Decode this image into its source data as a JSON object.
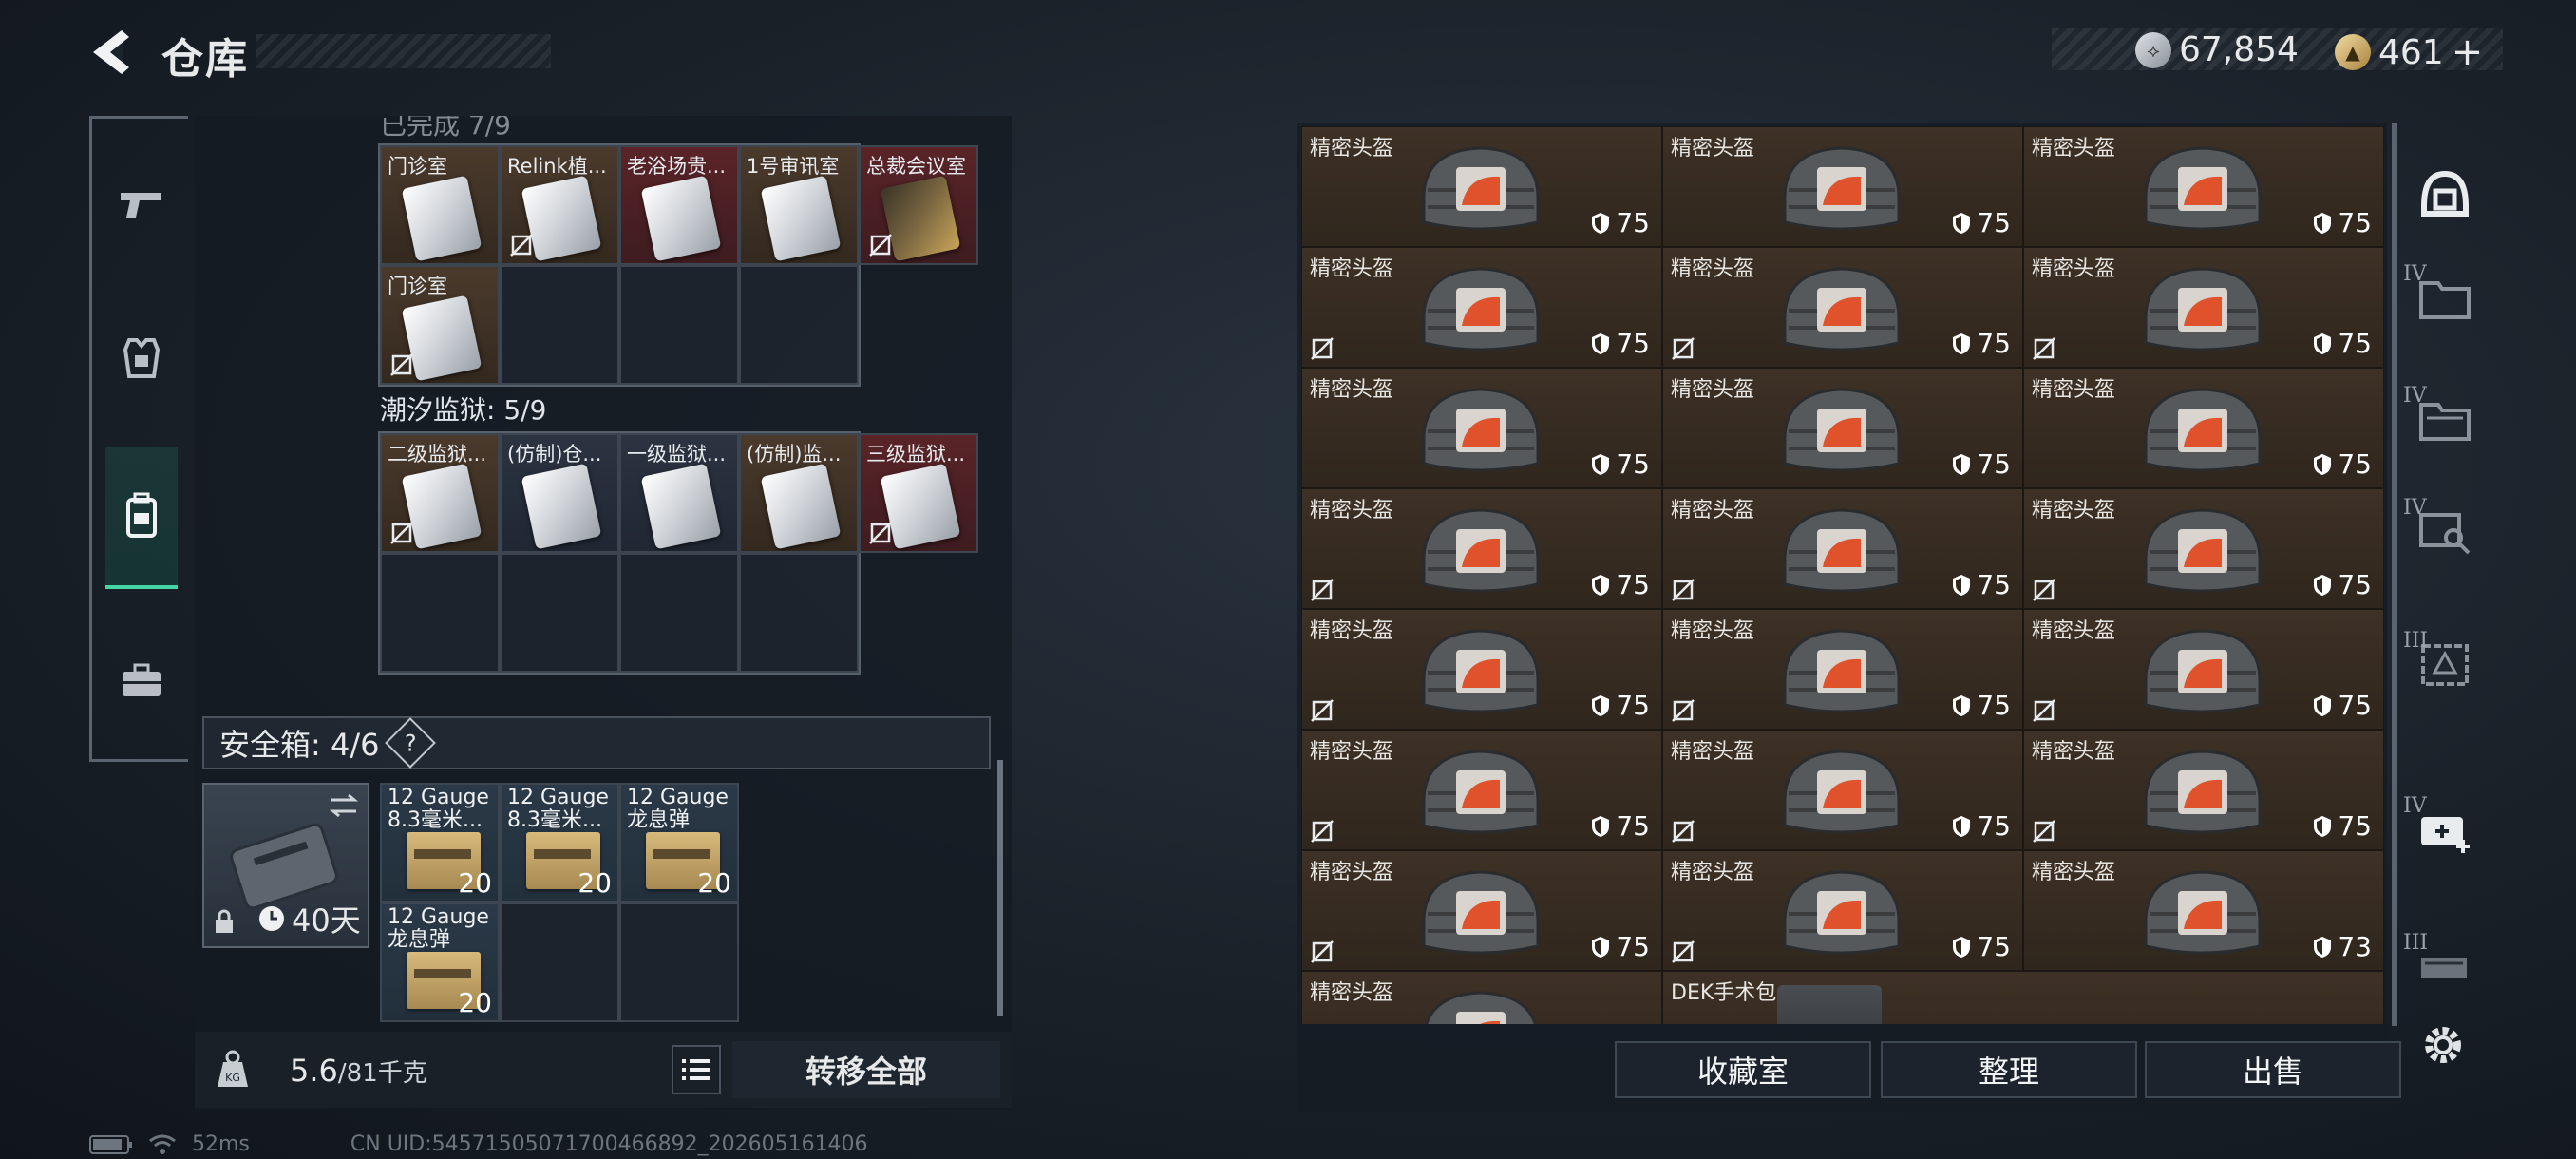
{
  "header": {
    "title": "仓库",
    "currency_silver": "67,854",
    "currency_gold": "461",
    "currency_add": "+"
  },
  "left_nav": [
    {
      "name": "weapons",
      "icon": "gun-icon"
    },
    {
      "name": "armor",
      "icon": "vest-icon"
    },
    {
      "name": "backpack",
      "icon": "backpack-icon"
    },
    {
      "name": "toolbox",
      "icon": "toolbox-icon"
    }
  ],
  "key_section_1": {
    "heading": "已完成 7/9",
    "cells": [
      {
        "label": "门诊室",
        "color": "tan",
        "no_trade": false,
        "gold": false
      },
      {
        "label": "Relink植...",
        "color": "tan",
        "no_trade": true,
        "gold": false
      },
      {
        "label": "老浴场贵...",
        "color": "red",
        "no_trade": false,
        "gold": false
      },
      {
        "label": "1号审讯室",
        "color": "tan",
        "no_trade": false,
        "gold": false
      },
      {
        "label": "总裁会议室",
        "color": "red",
        "no_trade": true,
        "gold": true
      },
      {
        "label": "门诊室",
        "color": "tan",
        "no_trade": true,
        "gold": false
      }
    ]
  },
  "key_section_2": {
    "heading": "潮汐监狱: 5/9",
    "cells": [
      {
        "label": "二级监狱...",
        "color": "tan",
        "no_trade": true
      },
      {
        "label": "(仿制)仓...",
        "color": "blue",
        "no_trade": false
      },
      {
        "label": "一级监狱...",
        "color": "blue",
        "no_trade": false
      },
      {
        "label": "(仿制)监...",
        "color": "tan",
        "no_trade": false
      },
      {
        "label": "三级监狱...",
        "color": "red",
        "no_trade": true
      }
    ]
  },
  "safe": {
    "heading": "安全箱: 4/6",
    "help": "?",
    "duration": "40天",
    "items": [
      {
        "line1": "12 Gauge",
        "line2": "8.3毫米...",
        "count": "20"
      },
      {
        "line1": "12 Gauge",
        "line2": "8.3毫米...",
        "count": "20"
      },
      {
        "line1": "12 Gauge",
        "line2": "龙息弹",
        "count": "20"
      },
      {
        "line1": "12 Gauge",
        "line2": "龙息弹",
        "count": "20"
      }
    ]
  },
  "weight": {
    "current": "5.6",
    "max": "/81千克",
    "transfer_all": "转移全部"
  },
  "helmets": {
    "label": "精密头盔",
    "rows": [
      [
        {
          "dur": "75",
          "nt": false
        },
        {
          "dur": "75",
          "nt": false
        },
        {
          "dur": "75",
          "nt": false
        }
      ],
      [
        {
          "dur": "75",
          "nt": true
        },
        {
          "dur": "75",
          "nt": true
        },
        {
          "dur": "75",
          "nt": true
        }
      ],
      [
        {
          "dur": "75",
          "nt": false
        },
        {
          "dur": "75",
          "nt": false
        },
        {
          "dur": "75",
          "nt": false
        }
      ],
      [
        {
          "dur": "75",
          "nt": true
        },
        {
          "dur": "75",
          "nt": true
        },
        {
          "dur": "75",
          "nt": true
        }
      ],
      [
        {
          "dur": "75",
          "nt": true
        },
        {
          "dur": "75",
          "nt": true
        },
        {
          "dur": "75",
          "nt": true
        }
      ],
      [
        {
          "dur": "75",
          "nt": true
        },
        {
          "dur": "75",
          "nt": true
        },
        {
          "dur": "75",
          "nt": true
        }
      ],
      [
        {
          "dur": "75",
          "nt": true
        },
        {
          "dur": "75",
          "nt": true
        },
        {
          "dur": "73",
          "nt": false
        }
      ]
    ],
    "partial_row": [
      "精密头盔",
      "DEK手术包"
    ]
  },
  "right_buttons": {
    "collection": "收藏室",
    "organize": "整理",
    "sell": "出售"
  },
  "side_tabs": [
    {
      "name": "helmet-tab",
      "badge": ""
    },
    {
      "name": "folder-tab-1",
      "badge": "IV"
    },
    {
      "name": "folder-tab-2",
      "badge": "IV"
    },
    {
      "name": "key-tab",
      "badge": "IV"
    },
    {
      "name": "map-tab",
      "badge": "III"
    },
    {
      "name": "medkit-tab",
      "badge": "IV"
    },
    {
      "name": "ammo-tab",
      "badge": "III"
    }
  ],
  "footer": {
    "ping": "52ms",
    "uid": "CN UID:54571505071700466892_202605161406"
  }
}
